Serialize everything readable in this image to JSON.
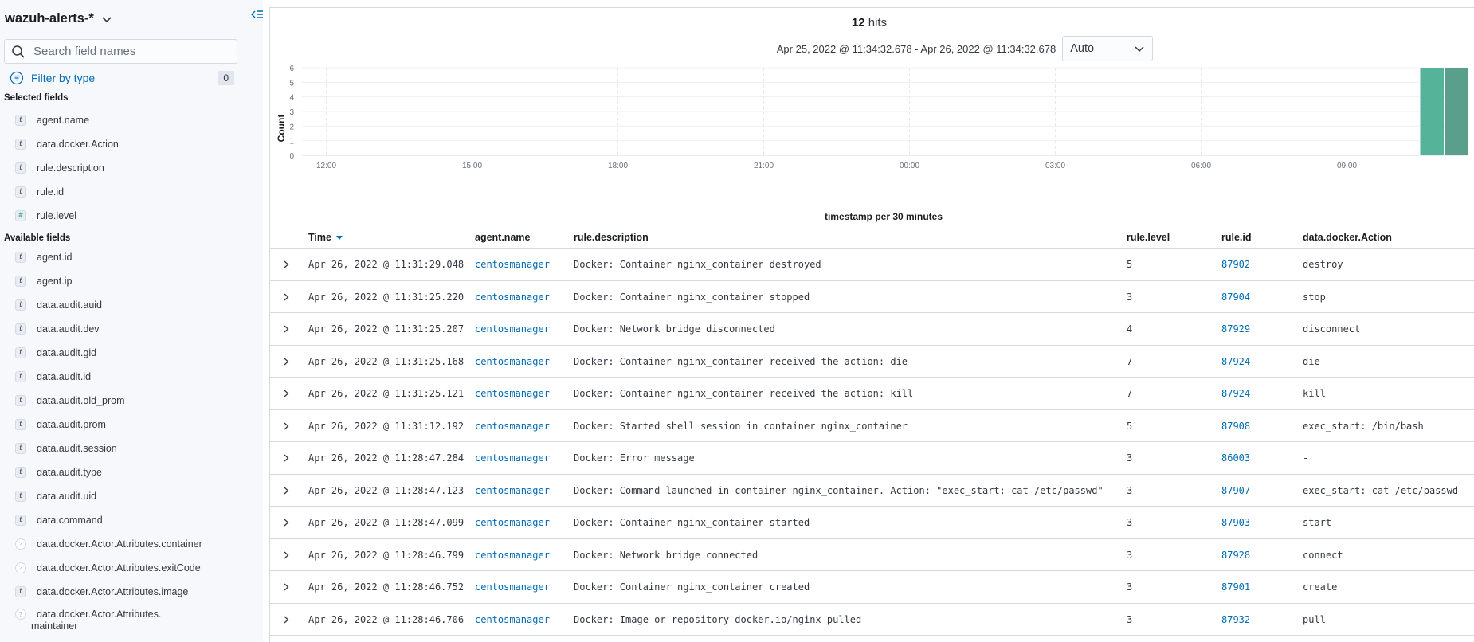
{
  "sidebar": {
    "index_pattern": "wazuh-alerts-*",
    "search_placeholder": "Search field names",
    "filter_label": "Filter by type",
    "filter_count": "0",
    "selected_title": "Selected fields",
    "selected_fields": [
      {
        "name": "agent.name",
        "type": "t"
      },
      {
        "name": "data.docker.Action",
        "type": "t"
      },
      {
        "name": "rule.description",
        "type": "t"
      },
      {
        "name": "rule.id",
        "type": "t"
      },
      {
        "name": "rule.level",
        "type": "#"
      }
    ],
    "available_title": "Available fields",
    "available_fields": [
      {
        "name": "agent.id",
        "type": "t"
      },
      {
        "name": "agent.ip",
        "type": "t"
      },
      {
        "name": "data.audit.auid",
        "type": "t"
      },
      {
        "name": "data.audit.dev",
        "type": "t"
      },
      {
        "name": "data.audit.gid",
        "type": "t"
      },
      {
        "name": "data.audit.id",
        "type": "t"
      },
      {
        "name": "data.audit.old_prom",
        "type": "t"
      },
      {
        "name": "data.audit.prom",
        "type": "t"
      },
      {
        "name": "data.audit.session",
        "type": "t"
      },
      {
        "name": "data.audit.type",
        "type": "t"
      },
      {
        "name": "data.audit.uid",
        "type": "t"
      },
      {
        "name": "data.command",
        "type": "t"
      },
      {
        "name": "data.docker.Actor.Attributes.container",
        "type": "?"
      },
      {
        "name": "data.docker.Actor.Attributes.exitCode",
        "type": "?"
      },
      {
        "name": "data.docker.Actor.Attributes.image",
        "type": "t"
      },
      {
        "name": "data.docker.Actor.Attributes.",
        "name2": "maintainer",
        "type": "?"
      }
    ]
  },
  "header": {
    "hits_count": "12",
    "hits_label": "hits",
    "time_range": "Apr 25, 2022 @ 11:34:32.678 - Apr 26, 2022 @ 11:34:32.678",
    "interval": "Auto"
  },
  "chart_data": {
    "type": "bar",
    "xlabel": "timestamp per 30 minutes",
    "ylabel": "Count",
    "ylim": [
      0,
      6
    ],
    "y_ticks": [
      "0",
      "1",
      "2",
      "3",
      "4",
      "5",
      "6"
    ],
    "x_ticks": [
      "12:00",
      "15:00",
      "18:00",
      "21:00",
      "00:00",
      "03:00",
      "06:00",
      "09:00"
    ],
    "x_start_hours": 11.5,
    "x_end_hours": 35.5,
    "bars": [
      {
        "start_hours": 34.5,
        "value": 6,
        "color": "#54b399"
      },
      {
        "start_hours": 35.0,
        "value": 6,
        "color": "#5a9e8c"
      }
    ],
    "grid": true
  },
  "table": {
    "columns": {
      "time": "Time",
      "agent": "agent.name",
      "description": "rule.description",
      "level": "rule.level",
      "id": "rule.id",
      "action": "data.docker.Action"
    },
    "rows": [
      {
        "time": "Apr 26, 2022 @ 11:31:29.048",
        "agent": "centosmanager",
        "description": "Docker: Container nginx_container destroyed",
        "level": "5",
        "id": "87902",
        "action": "destroy"
      },
      {
        "time": "Apr 26, 2022 @ 11:31:25.220",
        "agent": "centosmanager",
        "description": "Docker: Container nginx_container stopped",
        "level": "3",
        "id": "87904",
        "action": "stop"
      },
      {
        "time": "Apr 26, 2022 @ 11:31:25.207",
        "agent": "centosmanager",
        "description": "Docker: Network bridge disconnected",
        "level": "4",
        "id": "87929",
        "action": "disconnect"
      },
      {
        "time": "Apr 26, 2022 @ 11:31:25.168",
        "agent": "centosmanager",
        "description": "Docker: Container nginx_container received the action: die",
        "level": "7",
        "id": "87924",
        "action": "die"
      },
      {
        "time": "Apr 26, 2022 @ 11:31:25.121",
        "agent": "centosmanager",
        "description": "Docker: Container nginx_container received the action: kill",
        "level": "7",
        "id": "87924",
        "action": "kill"
      },
      {
        "time": "Apr 26, 2022 @ 11:31:12.192",
        "agent": "centosmanager",
        "description": "Docker: Started shell session in container nginx_container",
        "level": "5",
        "id": "87908",
        "action": "exec_start: /bin/bash"
      },
      {
        "time": "Apr 26, 2022 @ 11:28:47.284",
        "agent": "centosmanager",
        "description": "Docker: Error message",
        "level": "3",
        "id": "86003",
        "action": " -"
      },
      {
        "time": "Apr 26, 2022 @ 11:28:47.123",
        "agent": "centosmanager",
        "description": "Docker: Command launched in container nginx_container. Action: \"exec_start: cat /etc/passwd\"",
        "level": "3",
        "id": "87907",
        "action": "exec_start: cat /etc/passwd"
      },
      {
        "time": "Apr 26, 2022 @ 11:28:47.099",
        "agent": "centosmanager",
        "description": "Docker: Container nginx_container started",
        "level": "3",
        "id": "87903",
        "action": "start"
      },
      {
        "time": "Apr 26, 2022 @ 11:28:46.799",
        "agent": "centosmanager",
        "description": "Docker: Network bridge connected",
        "level": "3",
        "id": "87928",
        "action": "connect"
      },
      {
        "time": "Apr 26, 2022 @ 11:28:46.752",
        "agent": "centosmanager",
        "description": "Docker: Container nginx_container created",
        "level": "3",
        "id": "87901",
        "action": "create"
      },
      {
        "time": "Apr 26, 2022 @ 11:28:46.706",
        "agent": "centosmanager",
        "description": "Docker: Image or repository docker.io/nginx pulled",
        "level": "3",
        "id": "87932",
        "action": "pull"
      }
    ]
  }
}
